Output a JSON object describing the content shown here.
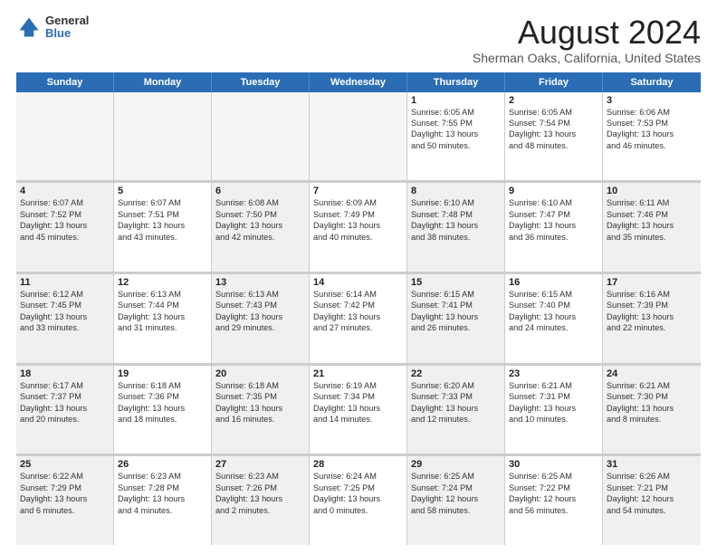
{
  "logo": {
    "general": "General",
    "blue": "Blue"
  },
  "title": "August 2024",
  "subtitle": "Sherman Oaks, California, United States",
  "days_of_week": [
    "Sunday",
    "Monday",
    "Tuesday",
    "Wednesday",
    "Thursday",
    "Friday",
    "Saturday"
  ],
  "rows": [
    [
      {
        "day": "",
        "info": "",
        "empty": true
      },
      {
        "day": "",
        "info": "",
        "empty": true
      },
      {
        "day": "",
        "info": "",
        "empty": true
      },
      {
        "day": "",
        "info": "",
        "empty": true
      },
      {
        "day": "1",
        "info": "Sunrise: 6:05 AM\nSunset: 7:55 PM\nDaylight: 13 hours\nand 50 minutes."
      },
      {
        "day": "2",
        "info": "Sunrise: 6:05 AM\nSunset: 7:54 PM\nDaylight: 13 hours\nand 48 minutes."
      },
      {
        "day": "3",
        "info": "Sunrise: 6:06 AM\nSunset: 7:53 PM\nDaylight: 13 hours\nand 46 minutes."
      }
    ],
    [
      {
        "day": "4",
        "info": "Sunrise: 6:07 AM\nSunset: 7:52 PM\nDaylight: 13 hours\nand 45 minutes.",
        "shaded": true
      },
      {
        "day": "5",
        "info": "Sunrise: 6:07 AM\nSunset: 7:51 PM\nDaylight: 13 hours\nand 43 minutes."
      },
      {
        "day": "6",
        "info": "Sunrise: 6:08 AM\nSunset: 7:50 PM\nDaylight: 13 hours\nand 42 minutes.",
        "shaded": true
      },
      {
        "day": "7",
        "info": "Sunrise: 6:09 AM\nSunset: 7:49 PM\nDaylight: 13 hours\nand 40 minutes."
      },
      {
        "day": "8",
        "info": "Sunrise: 6:10 AM\nSunset: 7:48 PM\nDaylight: 13 hours\nand 38 minutes.",
        "shaded": true
      },
      {
        "day": "9",
        "info": "Sunrise: 6:10 AM\nSunset: 7:47 PM\nDaylight: 13 hours\nand 36 minutes."
      },
      {
        "day": "10",
        "info": "Sunrise: 6:11 AM\nSunset: 7:46 PM\nDaylight: 13 hours\nand 35 minutes.",
        "shaded": true
      }
    ],
    [
      {
        "day": "11",
        "info": "Sunrise: 6:12 AM\nSunset: 7:45 PM\nDaylight: 13 hours\nand 33 minutes.",
        "shaded": true
      },
      {
        "day": "12",
        "info": "Sunrise: 6:13 AM\nSunset: 7:44 PM\nDaylight: 13 hours\nand 31 minutes."
      },
      {
        "day": "13",
        "info": "Sunrise: 6:13 AM\nSunset: 7:43 PM\nDaylight: 13 hours\nand 29 minutes.",
        "shaded": true
      },
      {
        "day": "14",
        "info": "Sunrise: 6:14 AM\nSunset: 7:42 PM\nDaylight: 13 hours\nand 27 minutes."
      },
      {
        "day": "15",
        "info": "Sunrise: 6:15 AM\nSunset: 7:41 PM\nDaylight: 13 hours\nand 26 minutes.",
        "shaded": true
      },
      {
        "day": "16",
        "info": "Sunrise: 6:15 AM\nSunset: 7:40 PM\nDaylight: 13 hours\nand 24 minutes."
      },
      {
        "day": "17",
        "info": "Sunrise: 6:16 AM\nSunset: 7:39 PM\nDaylight: 13 hours\nand 22 minutes.",
        "shaded": true
      }
    ],
    [
      {
        "day": "18",
        "info": "Sunrise: 6:17 AM\nSunset: 7:37 PM\nDaylight: 13 hours\nand 20 minutes.",
        "shaded": true
      },
      {
        "day": "19",
        "info": "Sunrise: 6:18 AM\nSunset: 7:36 PM\nDaylight: 13 hours\nand 18 minutes."
      },
      {
        "day": "20",
        "info": "Sunrise: 6:18 AM\nSunset: 7:35 PM\nDaylight: 13 hours\nand 16 minutes.",
        "shaded": true
      },
      {
        "day": "21",
        "info": "Sunrise: 6:19 AM\nSunset: 7:34 PM\nDaylight: 13 hours\nand 14 minutes."
      },
      {
        "day": "22",
        "info": "Sunrise: 6:20 AM\nSunset: 7:33 PM\nDaylight: 13 hours\nand 12 minutes.",
        "shaded": true
      },
      {
        "day": "23",
        "info": "Sunrise: 6:21 AM\nSunset: 7:31 PM\nDaylight: 13 hours\nand 10 minutes."
      },
      {
        "day": "24",
        "info": "Sunrise: 6:21 AM\nSunset: 7:30 PM\nDaylight: 13 hours\nand 8 minutes.",
        "shaded": true
      }
    ],
    [
      {
        "day": "25",
        "info": "Sunrise: 6:22 AM\nSunset: 7:29 PM\nDaylight: 13 hours\nand 6 minutes.",
        "shaded": true
      },
      {
        "day": "26",
        "info": "Sunrise: 6:23 AM\nSunset: 7:28 PM\nDaylight: 13 hours\nand 4 minutes."
      },
      {
        "day": "27",
        "info": "Sunrise: 6:23 AM\nSunset: 7:26 PM\nDaylight: 13 hours\nand 2 minutes.",
        "shaded": true
      },
      {
        "day": "28",
        "info": "Sunrise: 6:24 AM\nSunset: 7:25 PM\nDaylight: 13 hours\nand 0 minutes."
      },
      {
        "day": "29",
        "info": "Sunrise: 6:25 AM\nSunset: 7:24 PM\nDaylight: 12 hours\nand 58 minutes.",
        "shaded": true
      },
      {
        "day": "30",
        "info": "Sunrise: 6:25 AM\nSunset: 7:22 PM\nDaylight: 12 hours\nand 56 minutes."
      },
      {
        "day": "31",
        "info": "Sunrise: 6:26 AM\nSunset: 7:21 PM\nDaylight: 12 hours\nand 54 minutes.",
        "shaded": true
      }
    ]
  ]
}
